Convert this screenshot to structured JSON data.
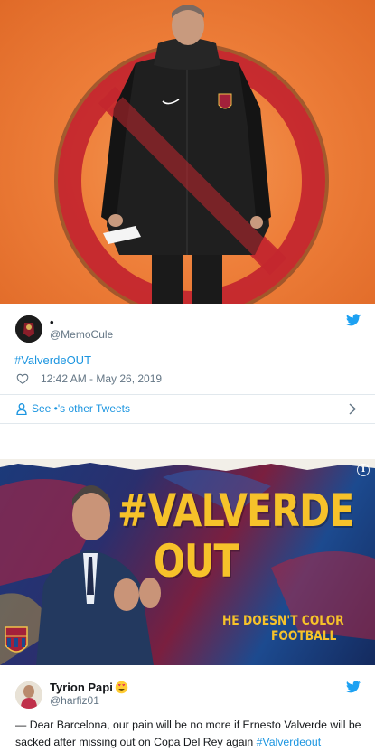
{
  "tweet1": {
    "name": "•",
    "handle": "@MemoCule",
    "hashtag": "#ValverdeOUT",
    "timestamp": "12:42 AM - May 26, 2019",
    "more_tweets": "See •'s other Tweets",
    "icons": [
      "twitter-bird-icon",
      "heart-icon",
      "person-icon",
      "chevron-right-icon"
    ]
  },
  "tweet2": {
    "image_text": {
      "headline_line1": "#VALVERDE",
      "headline_line2": "OUT",
      "tagline_line1": "HE DOESN'T COLOR",
      "tagline_line2": "FOOTBALL"
    },
    "name": "Tyrion Papi",
    "handle": "@harfiz01",
    "text_before": "— Dear Barcelona, our pain will be no more if Ernesto Valverde will be sacked after missing out on Copa Del Rey again ",
    "hashtag": "#Valverdeout",
    "icons": [
      "info-icon",
      "heart-eyes-emoji-icon",
      "twitter-bird-icon"
    ]
  },
  "colors": {
    "link": "#1b95e0",
    "secondary_text": "#657786",
    "divider": "#e1e8ed",
    "headline_yellow": "#f6c22a",
    "ban_red": "#c4272e"
  }
}
